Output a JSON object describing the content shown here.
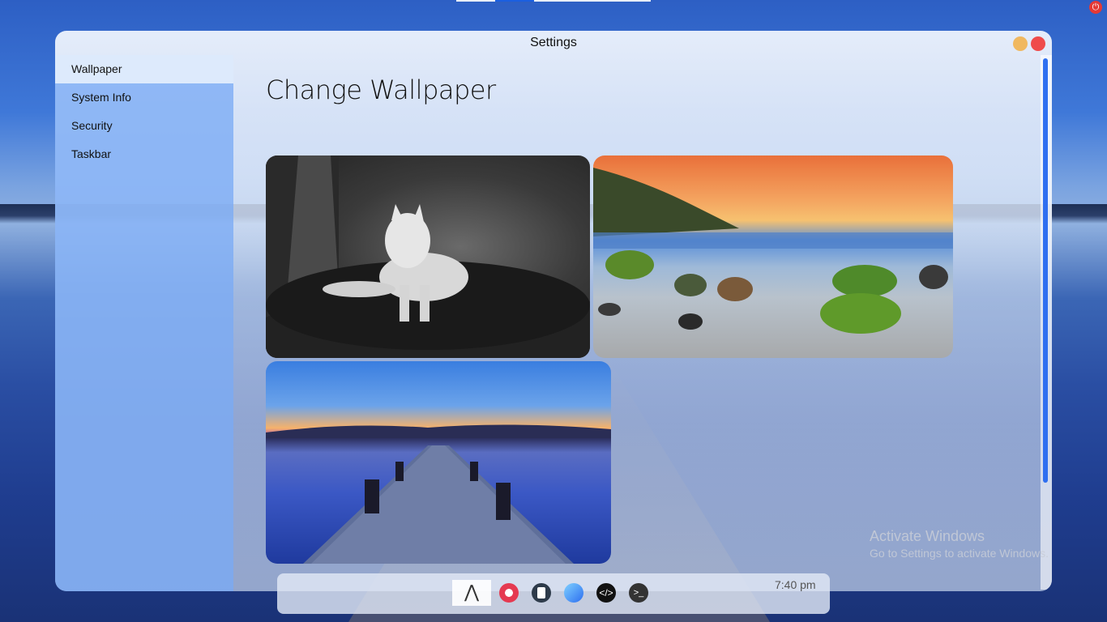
{
  "window": {
    "title": "Settings"
  },
  "sidebar": {
    "items": [
      {
        "label": "Wallpaper",
        "active": true
      },
      {
        "label": "System Info",
        "active": false
      },
      {
        "label": "Security",
        "active": false
      },
      {
        "label": "Taskbar",
        "active": false
      }
    ]
  },
  "main": {
    "heading": "Change Wallpaper",
    "wallpapers": [
      {
        "name": "wolf-wallpaper"
      },
      {
        "name": "beach-sunset-wallpaper"
      },
      {
        "name": "lake-pier-wallpaper"
      }
    ]
  },
  "watermark": {
    "title": "Activate Windows",
    "subtitle": "Go to Settings to activate Windows."
  },
  "taskbar": {
    "clock": "7:40 pm",
    "icons": [
      "launcher-icon",
      "app-red-icon",
      "notes-icon",
      "browser-icon",
      "code-icon",
      "terminal-icon"
    ]
  },
  "colors": {
    "accent": "#2f6ff0",
    "sidebar": "#7aaaf5",
    "close": "#ef4b4b",
    "minimize": "#f0b860",
    "power": "#e53935"
  }
}
